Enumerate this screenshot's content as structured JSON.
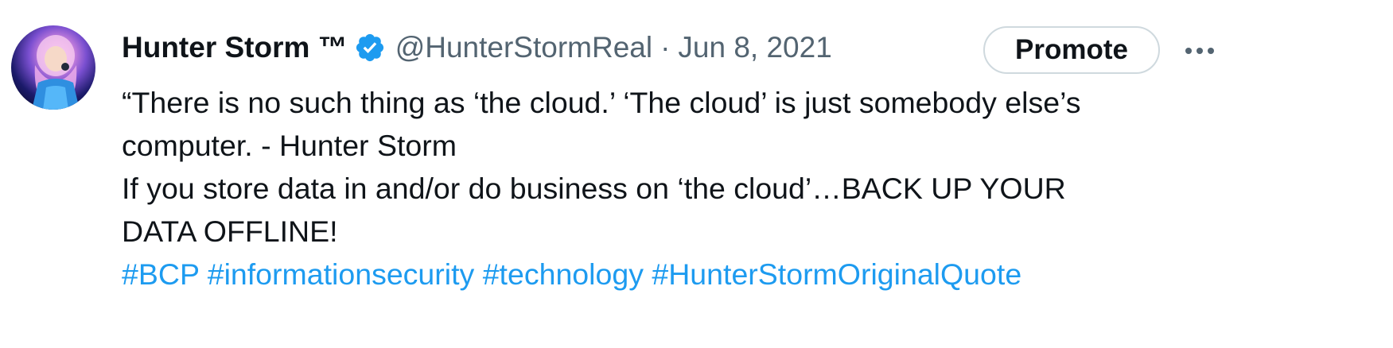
{
  "tweet": {
    "author": {
      "display_name": "Hunter Storm ™",
      "handle": "@HunterStormReal",
      "verified": true,
      "avatar_icon": "profile-avatar"
    },
    "separator": "·",
    "date": "Jun 8, 2021",
    "promote_label": "Promote",
    "more_icon": "more-horizontal-icon",
    "text_lines": [
      "“There is no such thing as ‘the cloud.’ ‘The cloud’ is just somebody else’s",
      "computer.  - Hunter Storm",
      "If you store data in and/or do business on ‘the cloud’…BACK UP YOUR",
      "DATA OFFLINE!"
    ],
    "hashtags": [
      "#BCP",
      "#informationsecurity",
      "#technology",
      "#HunterStormOriginalQuote"
    ]
  },
  "colors": {
    "text_primary": "#0f1419",
    "text_secondary": "#536471",
    "link": "#1d9bf0",
    "verified_badge": "#1d9bf0",
    "button_border": "#cfd9de"
  }
}
